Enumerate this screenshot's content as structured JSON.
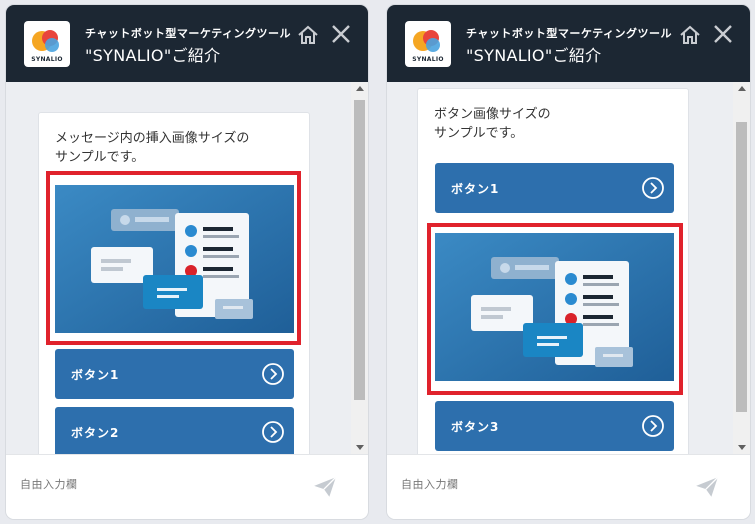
{
  "panels": [
    {
      "id": "left",
      "header": {
        "line1": "チャットボット型マーケティングツール",
        "line2": "\"SYNALIO\"ご紹介",
        "logo_text": "SYNALIO"
      },
      "message": [
        "メッセージ内の挿入画像サイズの",
        "サンプルです。"
      ],
      "buttons": [
        "ボタン1",
        "ボタン2"
      ],
      "input_placeholder": "自由入力欄"
    },
    {
      "id": "right",
      "header": {
        "line1": "チャットボット型マーケティングツール",
        "line2": "\"SYNALIO\"ご紹介",
        "logo_text": "SYNALIO"
      },
      "message": [
        "ボタン画像サイズの",
        "サンプルです。"
      ],
      "buttons": [
        "ボタン1",
        "ボタン3"
      ],
      "input_placeholder": "自由入力欄"
    }
  ],
  "icons": {
    "logo": "synalio-logo-icon",
    "home": "home-icon",
    "close": "close-icon",
    "button_arrow": "chevron-right-circle-icon",
    "send": "send-icon"
  },
  "colors": {
    "header_bg": "#1c2733",
    "button_bg": "#2d6fad",
    "highlight": "#e0222c",
    "illustration_bg": "#2a6ea8"
  }
}
